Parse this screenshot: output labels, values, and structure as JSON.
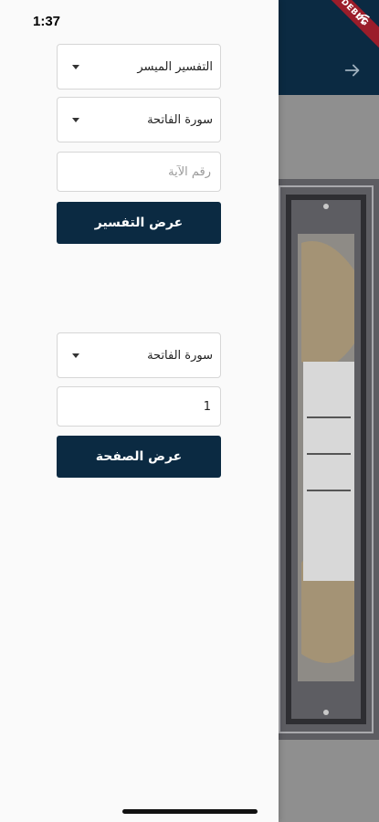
{
  "status_bar": {
    "time": "1:37"
  },
  "debug_banner": "DEBUG",
  "tafsir_section": {
    "tafsir_select": {
      "value": "التفسير الميسر"
    },
    "surah_select": {
      "value": "سورة الفاتحة"
    },
    "ayah_input": {
      "value": "",
      "placeholder": "رقم الآية"
    },
    "submit_label": "عرض التفسير"
  },
  "page_section": {
    "surah_select": {
      "value": "سورة الفاتحة"
    },
    "page_input": {
      "value": "1"
    },
    "submit_label": "عرض الصفحة"
  },
  "colors": {
    "primary": "#0b2a42",
    "drawer_bg": "#fafafa",
    "scrim": "#8f8f8f"
  },
  "icons": {
    "back": "arrow-forward-icon",
    "dropdown": "caret-down-icon"
  }
}
